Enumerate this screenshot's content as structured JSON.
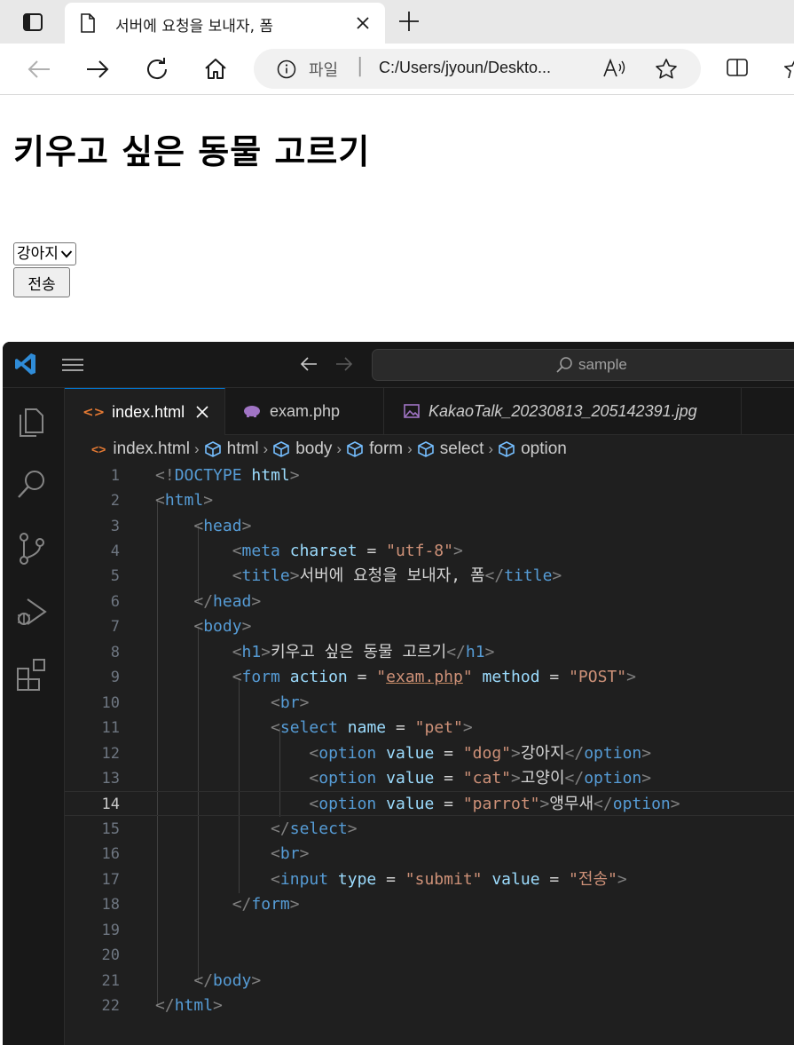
{
  "browser": {
    "tab_title": "서버에 요청을 보내자, 폼",
    "address_scheme": "파일",
    "address_separator": "|",
    "address_url": "C:/Users/jyoun/Deskto..."
  },
  "page": {
    "heading": "키우고 싶은 동물 고르기",
    "select_value": "강아지",
    "submit_label": "전송"
  },
  "vscode": {
    "search_text": "sample",
    "tabs": [
      {
        "label": "index.html",
        "color": "#ffffff"
      },
      {
        "label": "exam.php",
        "color": "#cccccc"
      },
      {
        "label": "KakaoTalk_20230813_205142391.jpg",
        "color": "#cccccc"
      }
    ],
    "breadcrumb": [
      "index.html",
      "html",
      "body",
      "form",
      "select",
      "option"
    ],
    "line_numbers": [
      "1",
      "2",
      "3",
      "4",
      "5",
      "6",
      "7",
      "8",
      "9",
      "10",
      "11",
      "12",
      "13",
      "14",
      "15",
      "16",
      "17",
      "18",
      "19",
      "20",
      "21",
      "22"
    ],
    "current_line": "14",
    "code": {
      "l1": {
        "open": "<!",
        "kw": "DOCTYPE",
        "attr": "html",
        "close": ">"
      },
      "l2": {
        "tag": "html"
      },
      "l3": {
        "tag": "head"
      },
      "l4": {
        "tag": "meta",
        "attr": "charset",
        "eq": " = ",
        "val": "\"utf-8\""
      },
      "l5": {
        "tag": "title",
        "text": "서버에 요청을 보내자, 폼",
        "endtag": "title"
      },
      "l6": {
        "tag": "head"
      },
      "l7": {
        "tag": "body"
      },
      "l8": {
        "tag": "h1",
        "text": "키우고 싶은 동물 고르기",
        "endtag": "h1"
      },
      "l9": {
        "tag": "form",
        "attr1": "action",
        "q1": "\"",
        "val1": "exam.php",
        "attr2": "method",
        "val2": "\"POST\""
      },
      "l10": {
        "tag": "br"
      },
      "l11": {
        "tag": "select",
        "attr": "name",
        "val": "\"pet\""
      },
      "l12": {
        "tag": "option",
        "attr": "value",
        "val": "\"dog\"",
        "text": "강아지",
        "endtag": "option"
      },
      "l13": {
        "tag": "option",
        "attr": "value",
        "val": "\"cat\"",
        "text": "고양이",
        "endtag": "option"
      },
      "l14": {
        "tag": "option",
        "attr": "value",
        "val": "\"parrot\"",
        "text": "앵무새",
        "endtag": "option"
      },
      "l15": {
        "tag": "select"
      },
      "l16": {
        "tag": "br"
      },
      "l17": {
        "tag": "input",
        "attr1": "type",
        "val1": "\"submit\"",
        "attr2": "value",
        "val2": "\"전송\""
      },
      "l18": {
        "tag": "form"
      },
      "l21": {
        "tag": "body"
      },
      "l22": {
        "tag": "html"
      }
    }
  }
}
